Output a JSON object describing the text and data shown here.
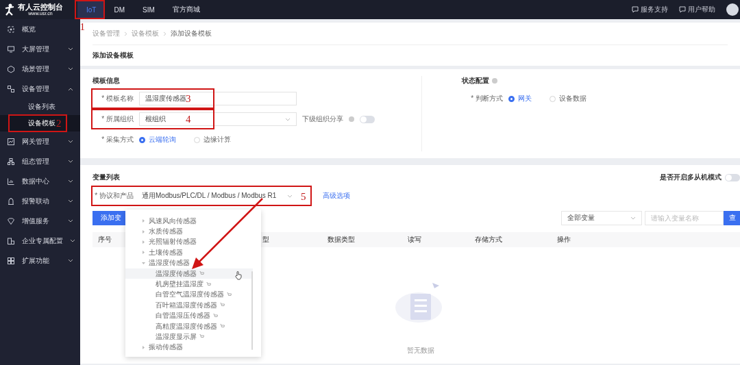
{
  "header": {
    "logo_title": "有人云控制台",
    "logo_subtitle": "www.usr.cn",
    "tabs": [
      {
        "label": "IoT",
        "selected": true,
        "annotation": "1"
      },
      {
        "label": "DM",
        "selected": false
      },
      {
        "label": "SIM",
        "selected": false
      },
      {
        "label": "官方商城",
        "selected": false
      }
    ],
    "links": [
      "服务支持",
      "用户帮助"
    ]
  },
  "sidebar": {
    "items": [
      {
        "label": "概览",
        "kind": "link"
      },
      {
        "label": "大屏管理",
        "kind": "group",
        "expanded": false
      },
      {
        "label": "场景管理",
        "kind": "group",
        "expanded": false
      },
      {
        "label": "设备管理",
        "kind": "group",
        "expanded": true,
        "children": [
          {
            "label": "设备列表",
            "selected": false
          },
          {
            "label": "设备模板",
            "selected": true,
            "annotation": "2"
          }
        ]
      },
      {
        "label": "网关管理",
        "kind": "group",
        "expanded": false
      },
      {
        "label": "组态管理",
        "kind": "group",
        "expanded": false
      },
      {
        "label": "数据中心",
        "kind": "group",
        "expanded": false
      },
      {
        "label": "报警联动",
        "kind": "group",
        "expanded": false
      },
      {
        "label": "增值服务",
        "kind": "group",
        "expanded": false
      },
      {
        "label": "企业专属配置",
        "kind": "group",
        "expanded": false
      },
      {
        "label": "扩展功能",
        "kind": "group",
        "expanded": false
      }
    ]
  },
  "breadcrumb": [
    "设备管理",
    "设备模板",
    "添加设备模板"
  ],
  "page_title": "添加设备模板",
  "template_info": {
    "title": "模板信息",
    "name_field": {
      "label": "* 模板名称",
      "value": "温湿度传感器",
      "annotation": "3"
    },
    "org_field": {
      "label": "* 所属组织",
      "value": "根组织",
      "annotation": "4"
    },
    "share": {
      "label": "下级组织分享",
      "on": false
    },
    "collect": {
      "label": "* 采集方式",
      "options": [
        {
          "label": "云端轮询",
          "selected": true
        },
        {
          "label": "边缘计算",
          "selected": false
        }
      ]
    }
  },
  "status_config": {
    "title": "状态配置",
    "judge": {
      "label": "* 判断方式",
      "options": [
        {
          "label": "网关",
          "selected": true
        },
        {
          "label": "设备数据",
          "selected": false
        }
      ]
    }
  },
  "variables": {
    "title": "变量列表",
    "multi_slave": {
      "label": "是否开启多从机模式",
      "on": false
    },
    "protocol": {
      "label": "* 协议和产品",
      "value": "通用Modbus/PLC/DL / Modbus / Modbus R1",
      "annotation": "5"
    },
    "advanced_link": "高级选项",
    "add_button": "添加变",
    "filter": {
      "value": "全部变量"
    },
    "search": {
      "placeholder": "请输入变量名称"
    },
    "search_button": "查",
    "columns": [
      "序号",
      "型",
      "数据类型",
      "读写",
      "存储方式",
      "操作"
    ],
    "empty_text": "暂无数据"
  },
  "dropdown": {
    "items": [
      {
        "label": "风速风向传感器",
        "expanded": false
      },
      {
        "label": "水质传感器",
        "expanded": false
      },
      {
        "label": "光照辐射传感器",
        "expanded": false
      },
      {
        "label": "土壤传感器",
        "expanded": false
      },
      {
        "label": "温湿度传感器",
        "expanded": true,
        "children": [
          {
            "label": "温湿度传感器",
            "hovered": true
          },
          {
            "label": "机房壁挂温湿度",
            "hovered": false
          },
          {
            "label": "白管空气温湿度传感器",
            "hovered": false
          },
          {
            "label": "百叶箱温湿度传感器",
            "hovered": false
          },
          {
            "label": "白管温湿压传感器",
            "hovered": false
          },
          {
            "label": "高精度温湿度传感器",
            "hovered": false
          },
          {
            "label": "温湿度显示屏",
            "hovered": false
          }
        ]
      },
      {
        "label": "振动传感器",
        "expanded": false
      }
    ]
  }
}
